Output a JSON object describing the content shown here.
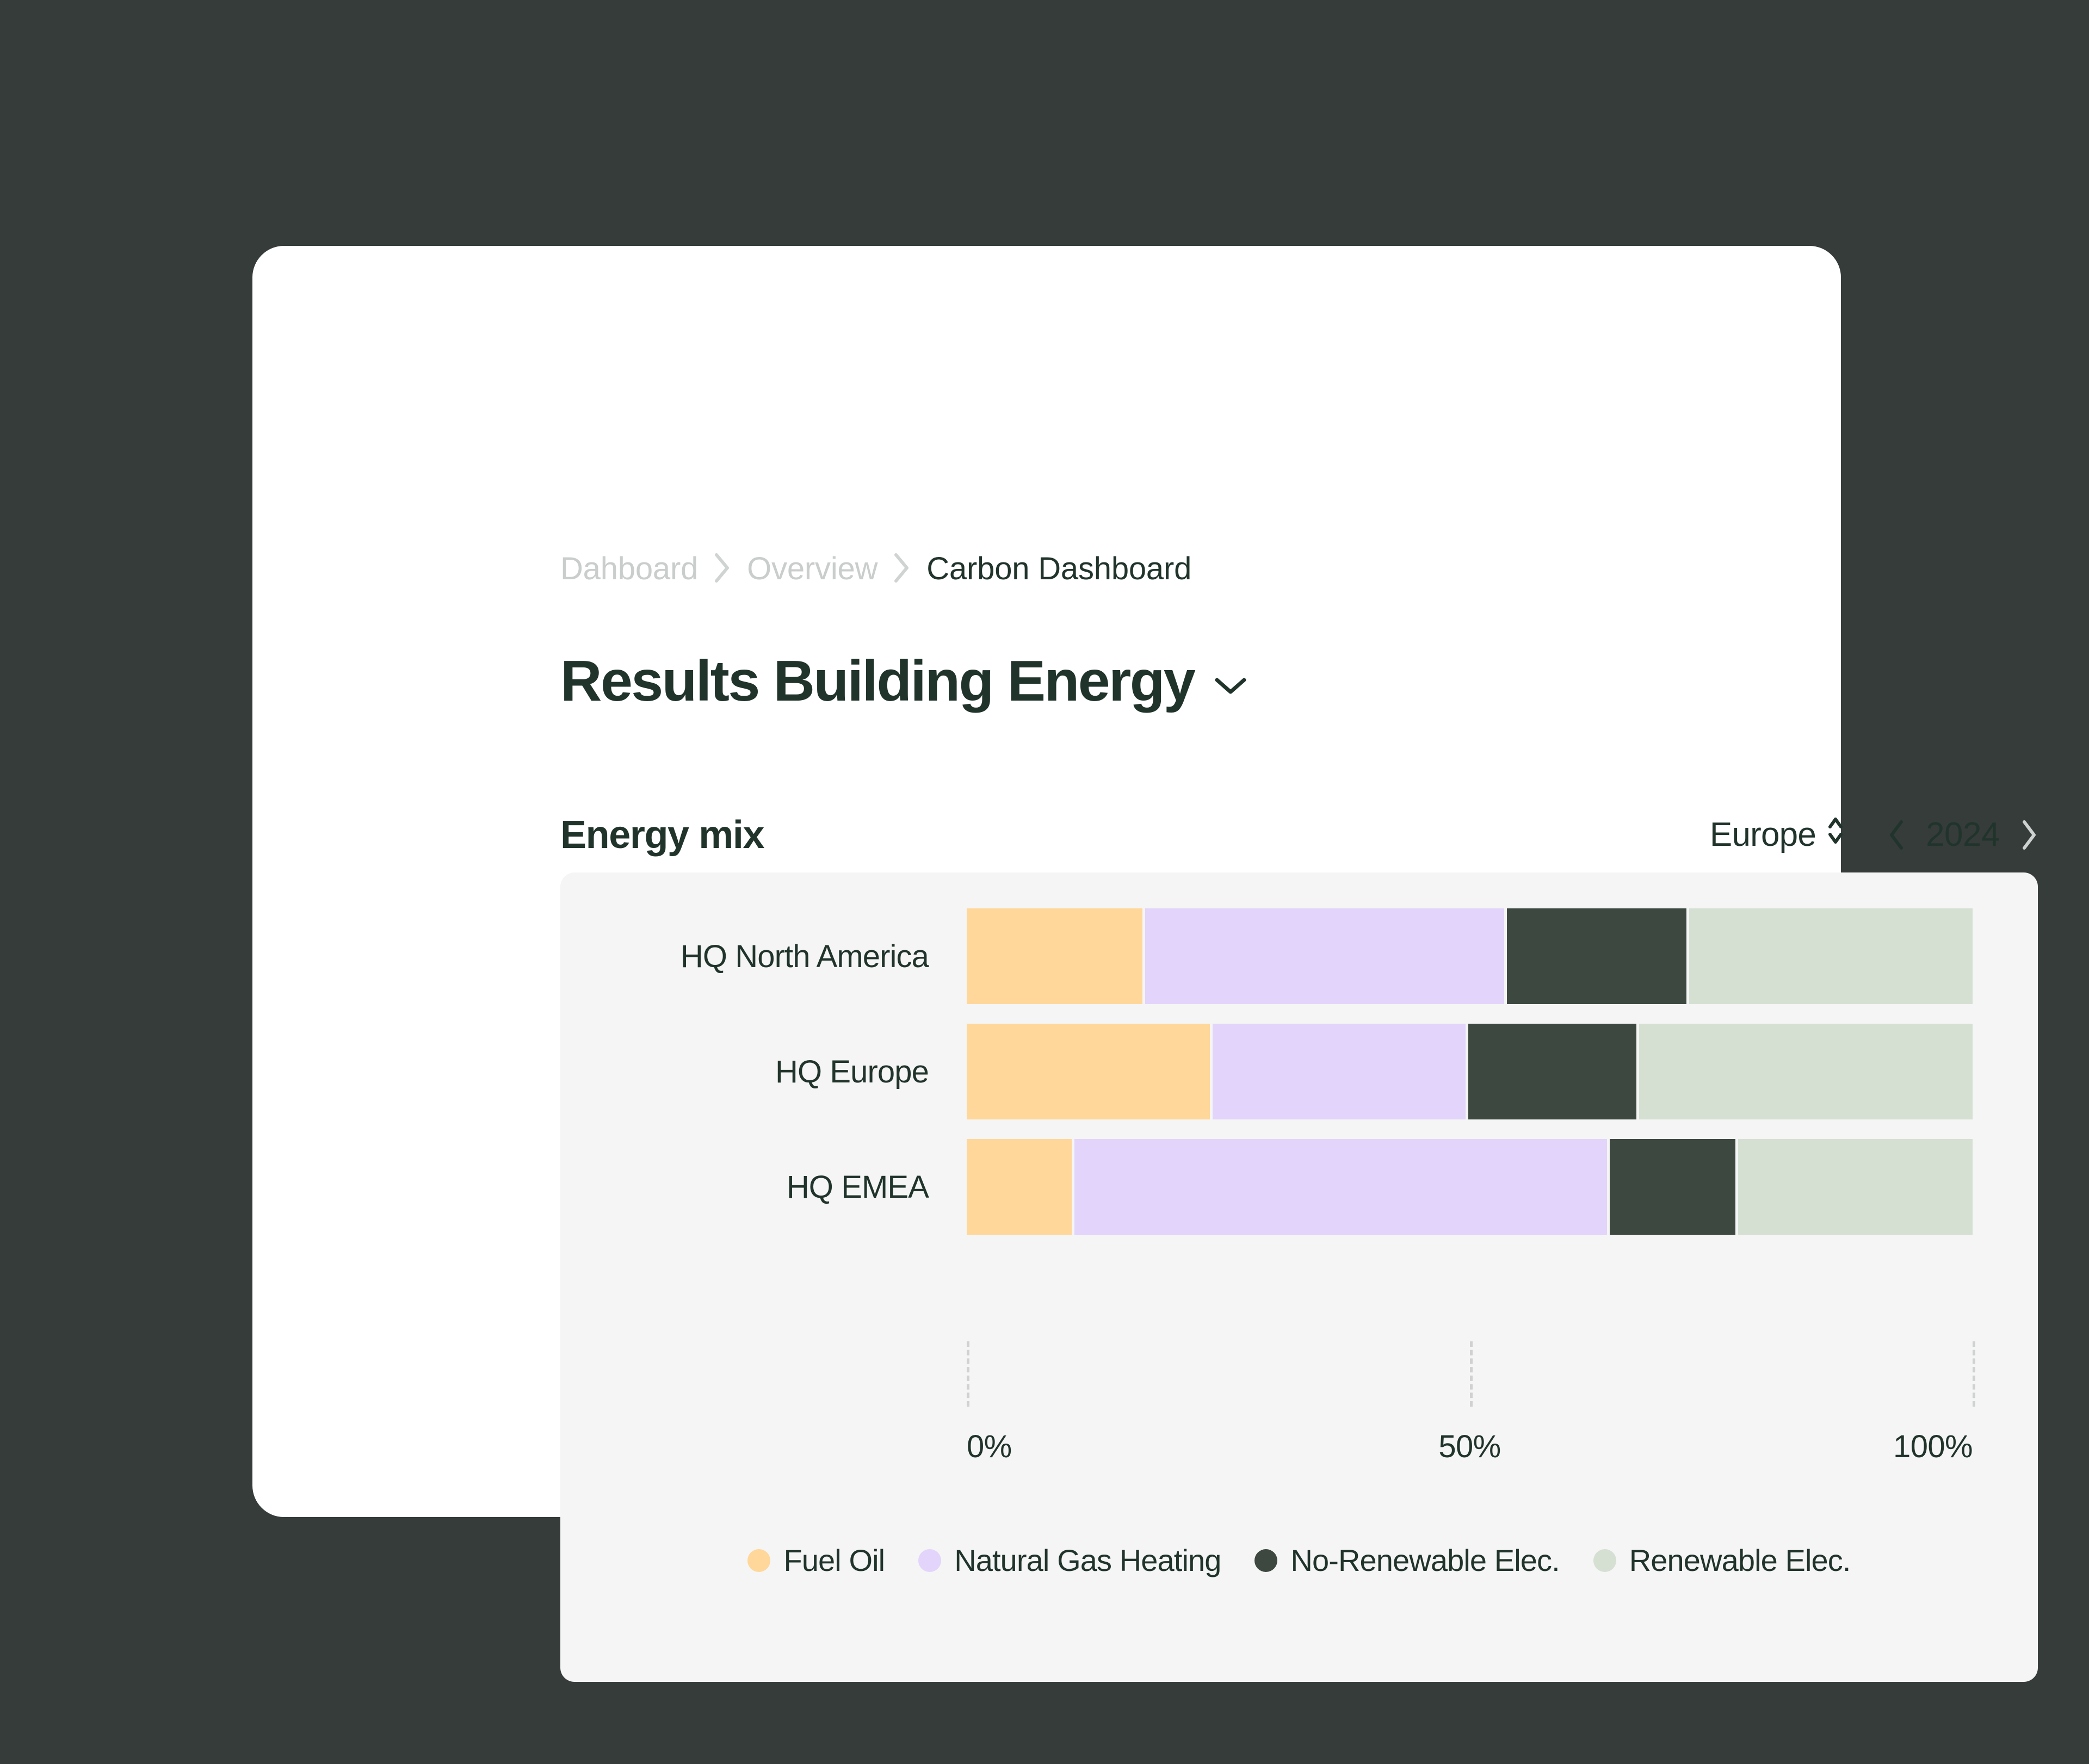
{
  "breadcrumb": {
    "items": [
      {
        "label": "Dahboard",
        "current": false
      },
      {
        "label": "Overview",
        "current": false
      },
      {
        "label": "Carbon Dashboard",
        "current": true
      }
    ],
    "separator_icon": "chevron-right-icon"
  },
  "header": {
    "title": "Results Building Energy",
    "title_chevron_icon": "chevron-down-icon"
  },
  "section": {
    "title": "Energy mix",
    "region": {
      "value": "Europe",
      "icon": "chevron-up-down-icon"
    },
    "year": {
      "value": "2024",
      "prev_icon": "chevron-left-icon",
      "next_icon": "chevron-right-icon"
    }
  },
  "colors": {
    "background": "#353c3a",
    "card": "#ffffff",
    "panel": "#f4f5f4",
    "text": "#21342c",
    "muted": "#c9cdcb",
    "fuel_oil": "#ffd79a",
    "natural_gas": "#e2d4fb",
    "non_renewable": "#3c4840",
    "renewable": "#d5e0d3"
  },
  "chart_data": {
    "type": "bar",
    "orientation": "horizontal",
    "stacked": true,
    "normalized": true,
    "title": "Energy mix",
    "xlabel": "",
    "ylabel": "",
    "xlim": [
      0,
      100
    ],
    "xticks": [
      0,
      50,
      100
    ],
    "xtick_labels": [
      "0%",
      "50%",
      "100%"
    ],
    "grid": "dashed-vertical",
    "legend_position": "bottom-center",
    "categories": [
      "HQ North America",
      "HQ Europe",
      "HQ EMEA"
    ],
    "series": [
      {
        "name": "Fuel Oil",
        "color": "#ffd79a",
        "values": [
          17.6,
          24.4,
          10.5
        ]
      },
      {
        "name": "Natural Gas Heating",
        "color": "#e2d4fb",
        "values": [
          36.0,
          25.3,
          53.4
        ]
      },
      {
        "name": "No-Renewable Elec.",
        "color": "#3c4840",
        "values": [
          18.0,
          16.9,
          12.6
        ]
      },
      {
        "name": "Renewable Elec.",
        "color": "#d5e0d3",
        "values": [
          28.4,
          33.4,
          23.5
        ]
      }
    ]
  }
}
